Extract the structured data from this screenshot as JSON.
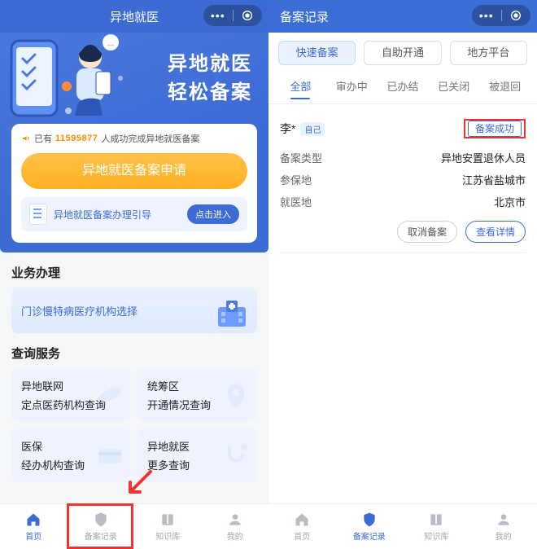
{
  "left": {
    "header": {
      "title": "异地就医"
    },
    "hero": {
      "title1": "异地就医",
      "title2": "轻松备案"
    },
    "count": {
      "prefix": "已有",
      "number": "11595877",
      "suffix": "人成功完成异地就医备案"
    },
    "apply_btn": "异地就医备案申请",
    "guide": {
      "text": "异地就医备案办理引导",
      "btn": "点击进入"
    },
    "biz_title": "业务办理",
    "biz_tile": "门诊慢特病医疗机构选择",
    "query_title": "查询服务",
    "tiles": [
      {
        "l1": "异地联网",
        "l2": "定点医药机构查询"
      },
      {
        "l1": "统筹区",
        "l2": "开通情况查询"
      },
      {
        "l1": "医保",
        "l2": "经办机构查询"
      },
      {
        "l1": "异地就医",
        "l2": "更多查询"
      }
    ],
    "tabs": [
      "首页",
      "备案记录",
      "知识库",
      "我的"
    ]
  },
  "right": {
    "header": {
      "title": "备案记录"
    },
    "top_tabs": [
      "快速备案",
      "自助开通",
      "地方平台"
    ],
    "sub_tabs": [
      "全部",
      "审办中",
      "已办结",
      "已关闭",
      "被退回"
    ],
    "record": {
      "name": "李*",
      "self_tag": "自己",
      "status": "备案成功",
      "rows": [
        {
          "k": "备案类型",
          "v": "异地安置退休人员"
        },
        {
          "k": "参保地",
          "v": "江苏省盐城市"
        },
        {
          "k": "就医地",
          "v": "北京市"
        }
      ],
      "actions": {
        "cancel": "取消备案",
        "detail": "查看详情"
      }
    },
    "tabs": [
      "首页",
      "备案记录",
      "知识库",
      "我的"
    ]
  }
}
